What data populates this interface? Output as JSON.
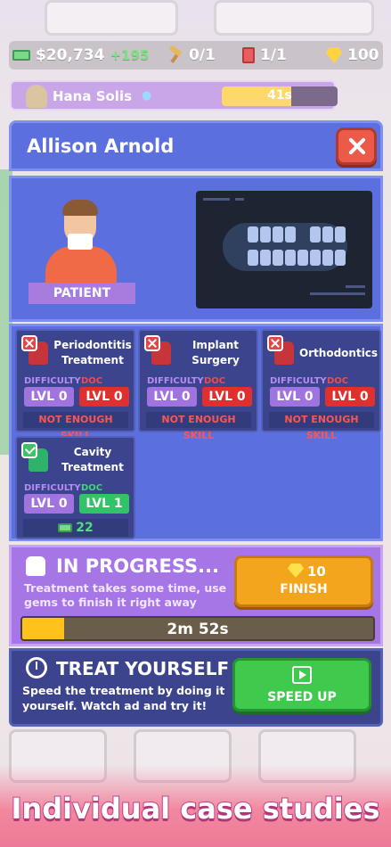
{
  "topbar": {
    "cash": "$20,734",
    "cash_gain": "+195",
    "tools": "0/1",
    "books": "1/1",
    "gems": "100"
  },
  "doctor": {
    "name": "Hana Solis",
    "timer": "41s",
    "timer_progress": 0.6
  },
  "patient": {
    "name": "Allison Arnold",
    "label": "PATIENT"
  },
  "labels": {
    "difficulty": "DIFFICULTY",
    "doc_skill": "DOC SKILL",
    "not_enough": "NOT ENOUGH SKILL"
  },
  "treatments": [
    {
      "name": "Periodontitis Treatment",
      "available": false,
      "difficulty": "LVL 0",
      "skill": "LVL 0"
    },
    {
      "name": "Implant Surgery",
      "available": false,
      "difficulty": "LVL 0",
      "skill": "LVL 0"
    },
    {
      "name": "Orthodontics",
      "available": false,
      "difficulty": "LVL 0",
      "skill": "LVL 0"
    },
    {
      "name": "Cavity Treatment",
      "available": true,
      "difficulty": "LVL 0",
      "skill": "LVL 1",
      "reward": "22"
    }
  ],
  "progress": {
    "title": "IN PROGRESS...",
    "description": "Treatment takes some time, use gems to finish it right away",
    "finish_cost": "10",
    "finish_label": "FINISH",
    "time_left": "2m 52s",
    "fraction": 0.12
  },
  "self_treat": {
    "title": "TREAT YOURSELF",
    "description": "Speed the treatment by doing it yourself. Watch ad and try it!",
    "button": "SPEED UP"
  },
  "caption": "Individual case studies",
  "colors": {
    "panel_blue": "#5c6fde",
    "card_navy": "#3b448d",
    "purple": "#a676e6",
    "finish_orange": "#f4a51e",
    "speed_green": "#3fc94d",
    "danger_red": "#e02f2f"
  }
}
